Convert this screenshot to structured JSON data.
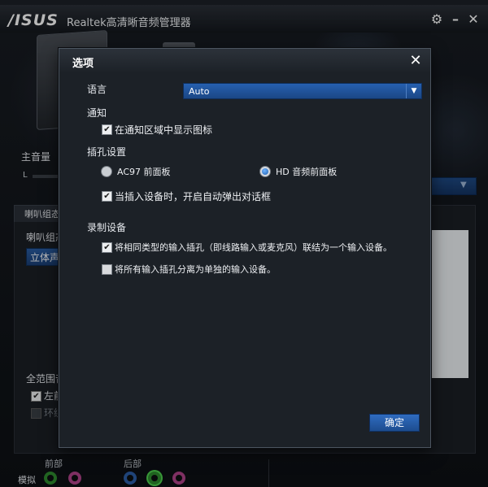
{
  "app": {
    "logo": "/ISUS",
    "title": "Realtek高清晰音频管理器"
  },
  "background": {
    "main_volume_label": "主音量",
    "left_channel": "L",
    "panel_tab": "喇叭组态",
    "config_label": "喇叭组态",
    "stereo_button": "立体声",
    "fullrange_label": "全范围音",
    "front_lr_label": "左前",
    "surround_label": "环绕",
    "front_label": "前部",
    "back_label": "后部",
    "analog_label": "模拟"
  },
  "dialog": {
    "title": "选项",
    "language_label": "语言",
    "language_value": "Auto",
    "notify_label": "通知",
    "show_tray_icon": "在通知区域中显示图标",
    "jack_settings_label": "插孔设置",
    "ac97_label": "AC97 前面板",
    "hd_label": "HD 音频前面板",
    "auto_popup": "当插入设备时，开启自动弹出对话框",
    "recording_label": "录制设备",
    "tie_inputs": "将相同类型的输入插孔（即线路输入或麦克风）联结为一个输入设备。",
    "separate_inputs": "将所有输入插孔分离为单独的输入设备。",
    "ok_button": "确定"
  },
  "state": {
    "show_tray_icon_checked": true,
    "ac97_selected": false,
    "hd_selected": true,
    "auto_popup_checked": true,
    "tie_inputs_checked": true,
    "separate_inputs_checked": false
  },
  "colors": {
    "accent_blue": "#2660b0",
    "dialog_bg": "#1c2127",
    "jack_green": "#2e8b2e",
    "jack_pink": "#b0438a",
    "jack_blue": "#2d5fa8"
  },
  "icons": {
    "settings": "gear-icon",
    "minimize": "minimize-icon",
    "close": "close-icon",
    "dropdown": "chevron-down-icon"
  }
}
